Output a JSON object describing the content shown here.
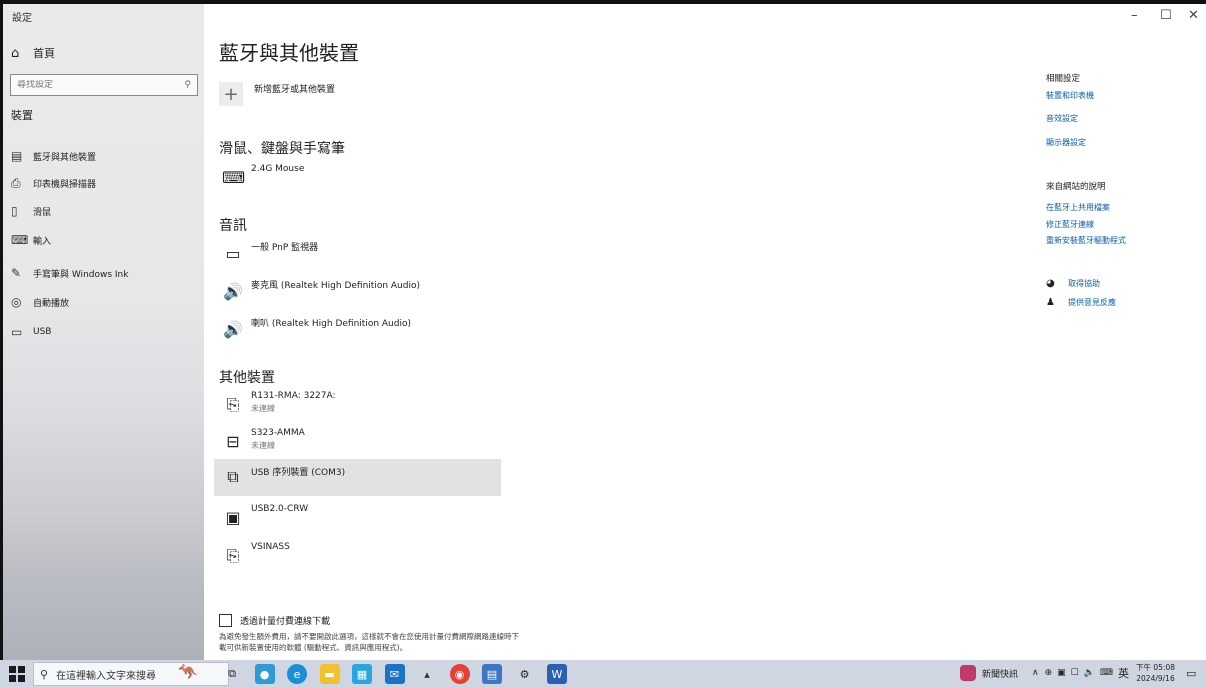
{
  "window": {
    "title": "設定",
    "minimize_glyph": "–",
    "maximize_glyph": "☐",
    "close_glyph": "✕"
  },
  "sidebar": {
    "home_label": "首頁",
    "search_placeholder": "尋找設定",
    "section_title": "裝置",
    "items": [
      {
        "label": "藍牙與其他裝置",
        "icon": "bluetooth-devices-icon"
      },
      {
        "label": "印表機與掃描器",
        "icon": "printer-icon"
      },
      {
        "label": "滑鼠",
        "icon": "mouse-icon"
      },
      {
        "label": "輸入",
        "icon": "keyboard-icon"
      },
      {
        "label": "手寫筆與 Windows Ink",
        "icon": "pen-icon"
      },
      {
        "label": "自動播放",
        "icon": "autoplay-icon"
      },
      {
        "label": "USB",
        "icon": "usb-icon"
      }
    ]
  },
  "main": {
    "title": "藍牙與其他裝置",
    "add_device_label": "新增藍牙或其他裝置",
    "groups": [
      {
        "title": "滑鼠、鍵盤與手寫筆",
        "devices": [
          {
            "name": "2.4G Mouse",
            "icon": "keyboard-icon"
          }
        ]
      },
      {
        "title": "音訊",
        "devices": [
          {
            "name": "一般 PnP 監視器",
            "icon": "monitor-icon"
          },
          {
            "name": "麥克風 (Realtek High Definition Audio)",
            "icon": "speaker-icon"
          },
          {
            "name": "喇叭 (Realtek High Definition Audio)",
            "icon": "speaker-icon"
          }
        ]
      },
      {
        "title": "其他裝置",
        "devices": [
          {
            "name": "R131-RMA: 3227A:",
            "status": "未連線",
            "icon": "media-device-icon"
          },
          {
            "name": "S323-AMMA",
            "status": "未連線",
            "icon": "pc-device-icon"
          },
          {
            "name": "USB 序列裝置 (COM3)",
            "icon": "serial-device-icon",
            "selected": true
          },
          {
            "name": "USB2.0-CRW",
            "icon": "card-reader-icon"
          },
          {
            "name": "VSINASS",
            "icon": "media-device-icon"
          }
        ]
      }
    ],
    "metered_label": "透過計量付費連線下載",
    "metered_checked": false,
    "metered_note": "為避免發生額外費用，請不要開啟此選項，這樣就不會在您使用計量付費網際網路連線時下載可供新裝置使用的軟體 (驅動程式、資訊與應用程式)。"
  },
  "related": {
    "title": "相關設定",
    "links": [
      "裝置和印表機",
      "音效設定",
      "顯示器設定"
    ]
  },
  "help": {
    "title": "來自網站的說明",
    "links": [
      "在藍牙上共用檔案",
      "修正藍牙連線",
      "重新安裝藍牙驅動程式"
    ]
  },
  "support": {
    "get_help": "取得協助",
    "feedback": "提供意見反應"
  },
  "taskbar": {
    "search_placeholder": "在這裡輸入文字來搜尋",
    "news_label": "新聞快訊",
    "ime_label": "英",
    "time": "下午 05:08",
    "date": "2024/9/16"
  }
}
